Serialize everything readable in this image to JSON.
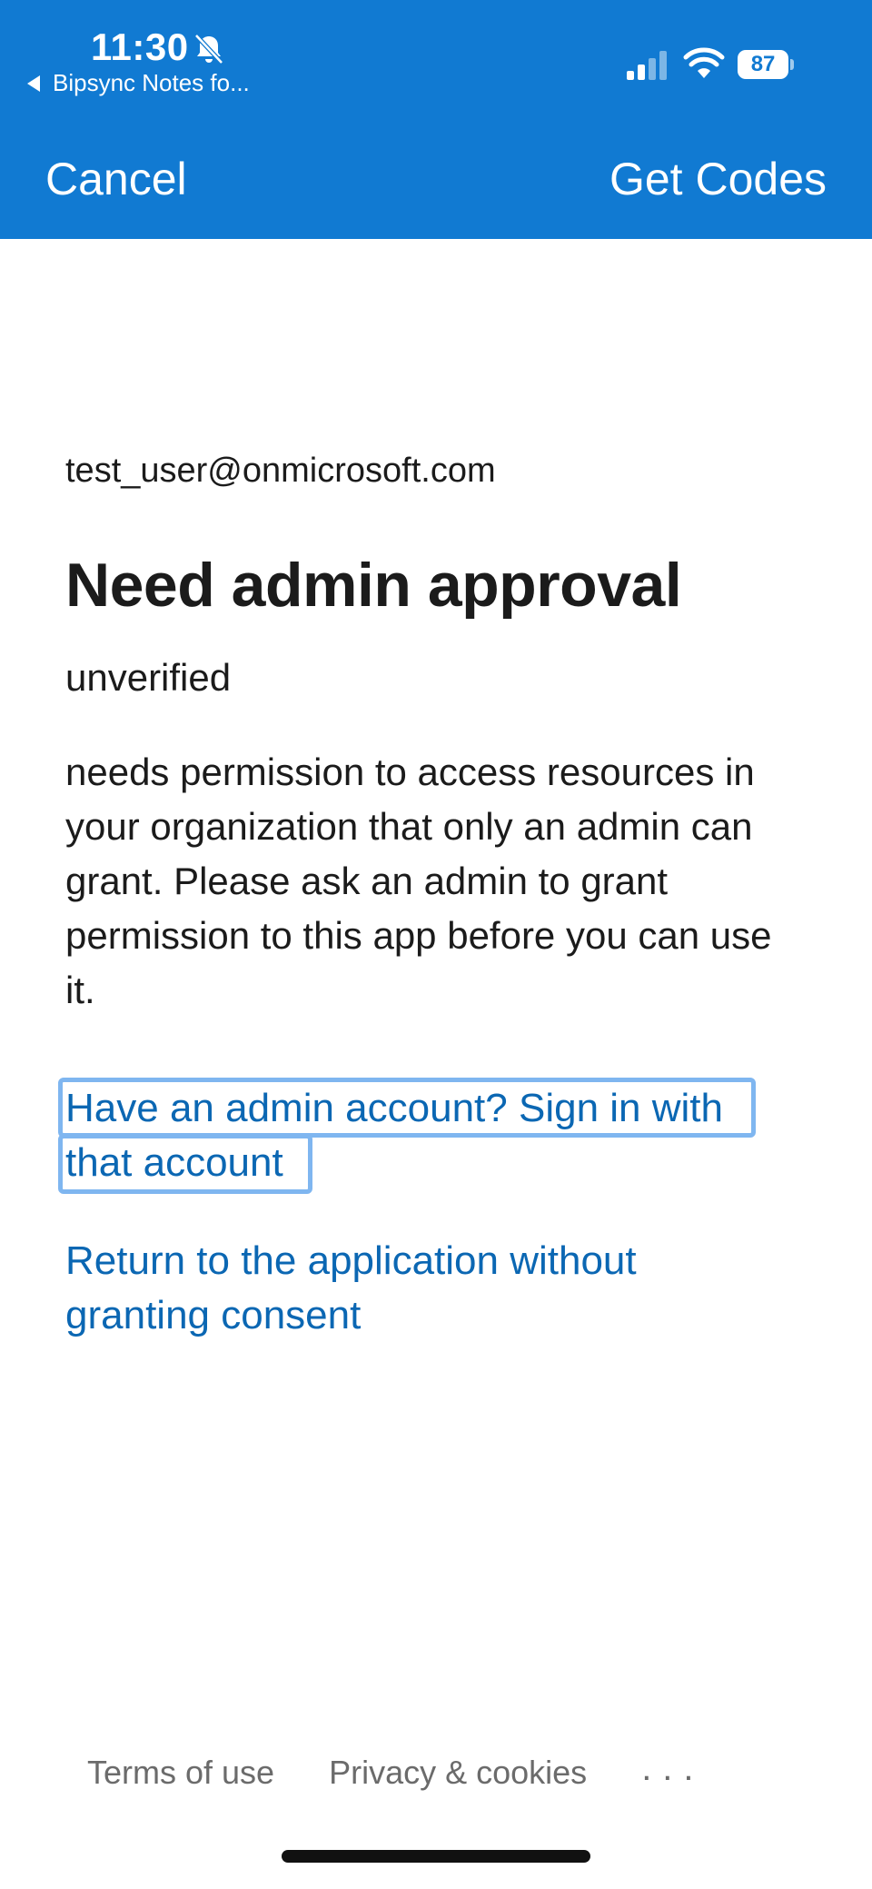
{
  "status_bar": {
    "time": "11:30",
    "back_app": "Bipsync Notes fo...",
    "battery": "87",
    "icons": [
      "bell-slash-icon",
      "signal-icon",
      "wifi-icon",
      "battery-icon"
    ]
  },
  "nav": {
    "cancel_label": "Cancel",
    "get_codes_label": "Get Codes"
  },
  "main": {
    "account_email": "test_user@onmicrosoft.com",
    "title": "Need admin approval",
    "app_name": "unverified",
    "message": "needs permission to access resources in your organization that only an admin can grant. Please ask an admin to grant permission to this app before you can use it.",
    "admin_link": "Have an admin account? Sign in with that account",
    "return_link": "Return to the application without granting consent"
  },
  "footer": {
    "terms": "Terms of use",
    "privacy": "Privacy & cookies",
    "more": "..."
  },
  "colors": {
    "header_bg": "#117ad2",
    "link": "#0b67b3",
    "focus_outline": "#7fb6f0",
    "text": "#1b1b1b",
    "footer_text": "#6b6b6b"
  }
}
